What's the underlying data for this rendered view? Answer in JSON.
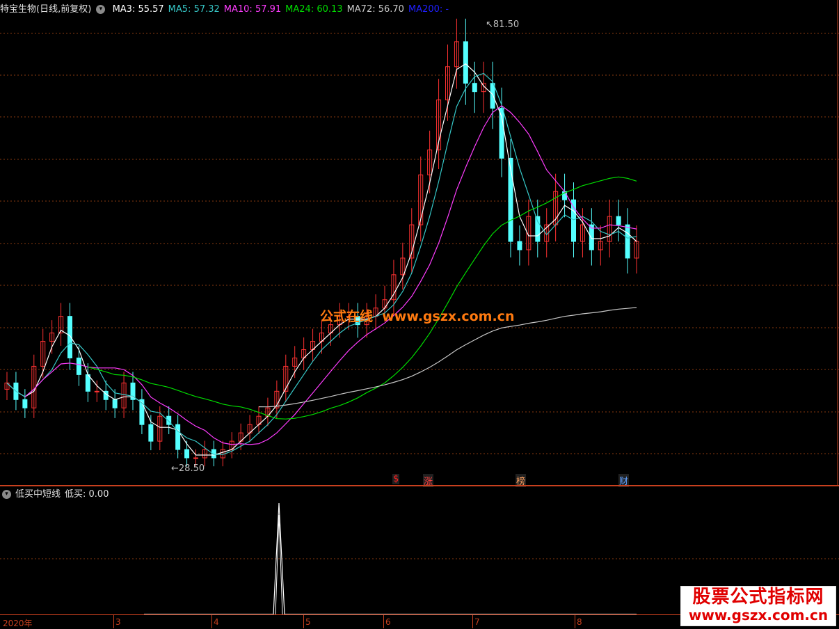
{
  "main": {
    "stock_name": "特宝生物(日线,前复权)",
    "indicators": [
      {
        "label": "MA3",
        "value": "55.57",
        "color": "#ffffff"
      },
      {
        "label": "MA5",
        "value": "57.32",
        "color": "#36c8c8"
      },
      {
        "label": "MA10",
        "value": "57.91",
        "color": "#ff3cff"
      },
      {
        "label": "MA24",
        "value": "60.13",
        "color": "#00dd00"
      },
      {
        "label": "MA72",
        "value": "56.70",
        "color": "#c8c8c8"
      },
      {
        "label": "MA200",
        "value": "-",
        "color": "#2020ff"
      }
    ],
    "price_high_label": "81.50",
    "price_low_label": "28.50",
    "markers": [
      {
        "text": "$",
        "color": "#ff2020"
      },
      {
        "text": "涨",
        "color": "#ff4040"
      },
      {
        "text": "榜",
        "color": "#ffa060"
      },
      {
        "text": "财",
        "color": "#60a0ff"
      }
    ]
  },
  "sub": {
    "indicator_name": "低买中短线",
    "value_label": "低买: 0.00"
  },
  "xaxis": {
    "year_label": "2020年",
    "months": [
      "3",
      "4",
      "5",
      "6",
      "7",
      "8"
    ]
  },
  "watermark": {
    "cn": "公式在线",
    "url": "www.gszx.com.cn"
  },
  "brand": {
    "line1": "股票公式指标网",
    "line2": "www.gszx.com.cn"
  },
  "chart_data": {
    "type": "candlestick",
    "title": "特宝生物(日线,前复权)",
    "high": 81.5,
    "low": 28.5,
    "moving_averages": {
      "MA3": 55.57,
      "MA5": 57.32,
      "MA10": 57.91,
      "MA24": 60.13,
      "MA72": 56.7,
      "MA200": null
    },
    "closes": [
      38,
      36,
      35,
      40,
      43,
      44,
      46,
      41,
      39,
      37,
      37,
      36,
      35,
      38,
      36,
      33,
      31,
      34,
      33,
      30,
      29,
      29,
      30,
      29,
      30,
      31,
      32,
      33,
      34,
      35,
      37,
      40,
      41,
      42,
      43,
      44,
      45,
      46,
      46,
      45,
      46,
      47,
      48,
      51,
      53,
      57,
      63,
      66,
      72,
      76,
      79,
      74,
      73,
      74,
      71,
      65,
      55,
      54,
      58,
      55,
      57,
      61,
      60,
      55,
      57,
      54,
      55,
      58,
      57,
      53,
      55
    ],
    "sub_indicator": {
      "name": "低买中短线",
      "low_buy": 0.0
    }
  }
}
